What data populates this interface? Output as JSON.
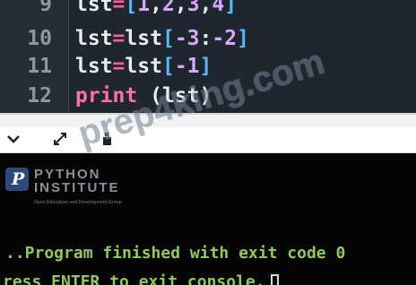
{
  "editor": {
    "lines": [
      {
        "number": "9",
        "tokens": [
          "lst",
          "=",
          "[",
          "1",
          ",",
          "2",
          ",",
          "3",
          ",",
          "4",
          "]"
        ]
      },
      {
        "number": "10",
        "tokens": [
          "lst",
          "=",
          "lst",
          "[",
          "-3",
          ":",
          "-2",
          "]"
        ]
      },
      {
        "number": "11",
        "tokens": [
          "lst",
          "=",
          "lst",
          "[",
          "-1",
          "]"
        ]
      },
      {
        "number": "12",
        "tokens": [
          "print",
          " (",
          "lst",
          ")"
        ]
      }
    ]
  },
  "toolbar": {
    "icons": [
      "chevron-down-icon",
      "expand-icon",
      "stdin-icon"
    ]
  },
  "console": {
    "logo_letter": "P",
    "logo_line1": "PYTHON",
    "logo_line2": "INSTITUTE",
    "logo_tagline": "Open Education and Development Group",
    "output_line1": "..Program finished with exit code 0",
    "output_line2": "ress ENTER to exit console."
  },
  "watermark": {
    "text": "prep4king.com"
  },
  "colors": {
    "editor_bg": "#1f262d",
    "console_bg": "#050505",
    "console_text": "#91c85a"
  }
}
